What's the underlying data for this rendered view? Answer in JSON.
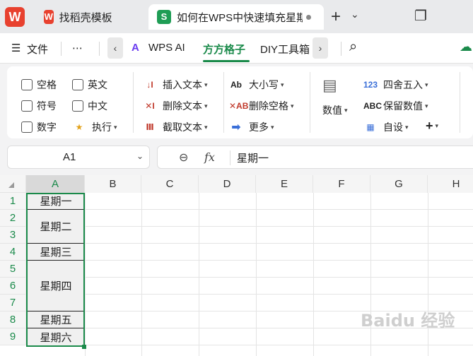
{
  "titlebar": {
    "tabs": [
      {
        "title": "找稻壳模板",
        "icon": "W"
      },
      {
        "title": "如何在WPS中快速填充星期",
        "icon": "S"
      }
    ],
    "plus": "+",
    "chevron": "⌄",
    "restore": "❐"
  },
  "menubar": {
    "hamburger": "☰",
    "file": "文件",
    "more": "⋯",
    "left_arrow": "‹",
    "wps_ai": "WPS AI",
    "fangfang": "方方格子",
    "diy": "DIY工具箱",
    "right_arrow": "›",
    "search": "⌕",
    "cloud": "☁"
  },
  "ribbon": {
    "checkboxes": [
      "空格",
      "英文",
      "符号",
      "中文",
      "数字"
    ],
    "execute": "执行",
    "insert_text": "插入文本",
    "delete_text": "删除文本",
    "cut_text": "截取文本",
    "case": "大小写",
    "delete_space": "删除空格",
    "more": "更多",
    "value": "数值",
    "round": "四舍五入",
    "keep_value": "保留数值",
    "custom": "自设",
    "plus": "+"
  },
  "formula_bar": {
    "name_box": "A1",
    "fx": "fx",
    "value": "星期一"
  },
  "grid": {
    "columns": [
      "A",
      "B",
      "C",
      "D",
      "E",
      "F",
      "G",
      "H"
    ],
    "rows": [
      "1",
      "2",
      "3",
      "4",
      "5",
      "6",
      "7",
      "8",
      "9"
    ],
    "cells": [
      "星期一",
      "星期二",
      "星期三",
      "星期四",
      "星期五",
      "星期六"
    ]
  },
  "watermark": "Baidu 经验"
}
